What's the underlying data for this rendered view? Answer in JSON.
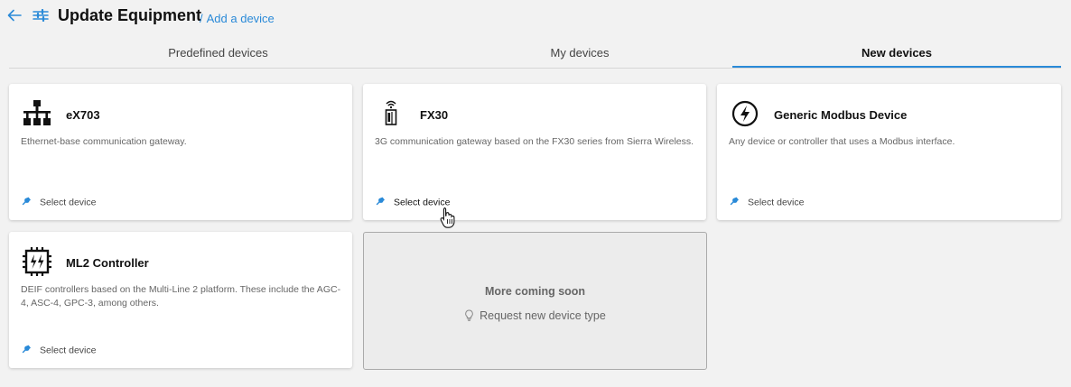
{
  "header": {
    "title": "Update Equipment",
    "breadcrumb_sep": "/",
    "breadcrumb": "Add a device"
  },
  "tabs": [
    {
      "label": "Predefined devices"
    },
    {
      "label": "My devices"
    },
    {
      "label": "New devices",
      "active": true
    }
  ],
  "cards": [
    {
      "title": "eX703",
      "description": "Ethernet-base communication gateway.",
      "action": "Select device",
      "icon": "network-icon"
    },
    {
      "title": "FX30",
      "description": "3G communication gateway based on the FX30 series from Sierra Wireless.",
      "action": "Select device",
      "icon": "wireless-gateway-icon"
    },
    {
      "title": "Generic Modbus Device",
      "description": "Any device or controller that uses a Modbus interface.",
      "action": "Select device",
      "icon": "lightning-circle-icon"
    },
    {
      "title": "ML2 Controller",
      "description": "DEIF controllers based on the Multi-Line 2 platform. These include the AGC-4, ASC-4, GPC-3, among others.",
      "action": "Select device",
      "icon": "controller-icon"
    }
  ],
  "coming_soon": {
    "title": "More coming soon",
    "request_label": "Request new device type",
    "icon": "lightbulb-icon"
  },
  "colors": {
    "accent": "#2a8ad8",
    "background": "#f2f2f2"
  }
}
